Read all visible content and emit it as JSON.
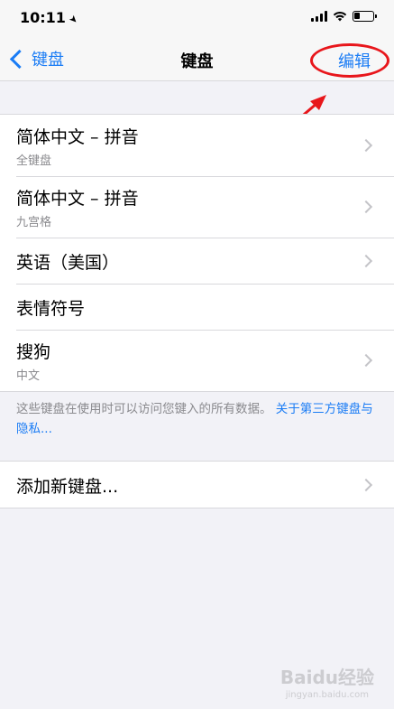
{
  "status_bar": {
    "time": "10:11",
    "location_icon": "location-arrow-icon",
    "battery_level": 0.3
  },
  "nav": {
    "back_label": "键盘",
    "title": "键盘",
    "edit_label": "编辑"
  },
  "keyboards": [
    {
      "title": "简体中文 – 拼音",
      "subtitle": "全键盘"
    },
    {
      "title": "简体中文 – 拼音",
      "subtitle": "九宫格"
    },
    {
      "title": "英语（美国）",
      "subtitle": ""
    },
    {
      "title": "表情符号",
      "subtitle": ""
    },
    {
      "title": "搜狗",
      "subtitle": "中文"
    }
  ],
  "footer": {
    "text": "这些键盘在使用时可以访问您键入的所有数据。",
    "link": "关于第三方键盘与隐私..."
  },
  "add_keyboard": {
    "label": "添加新键盘..."
  },
  "watermark": {
    "text": "Baidu经验",
    "sub": "jingyan.baidu.com"
  },
  "colors": {
    "accent": "#1a7cf5",
    "annotation": "#e8161b",
    "background": "#f2f2f7"
  }
}
